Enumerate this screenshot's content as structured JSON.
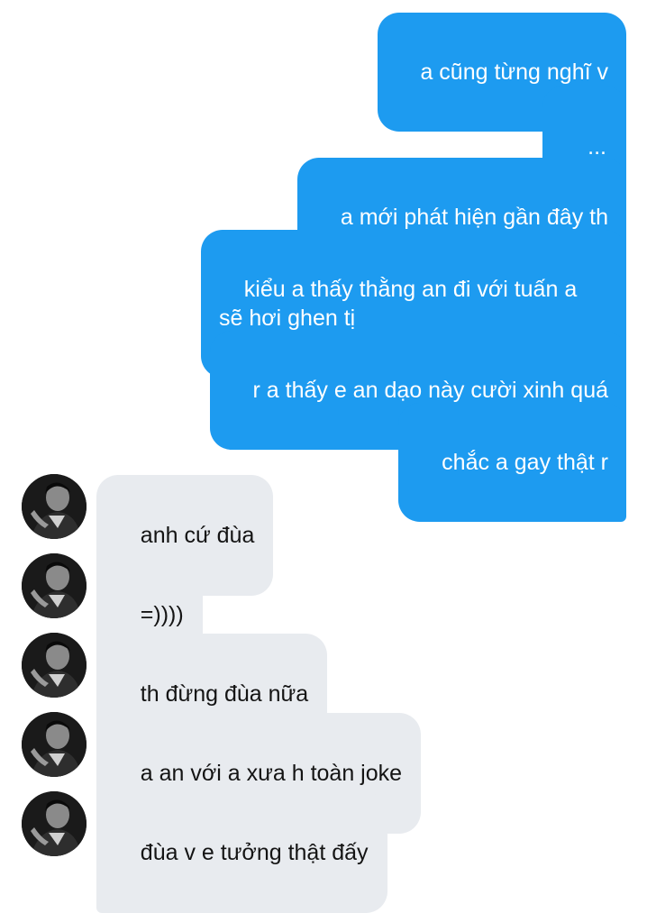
{
  "conversation": {
    "sent_messages": [
      {
        "text": "a cũng từng nghĩ v"
      },
      {
        "text": "..."
      },
      {
        "text": "a mới phát hiện gần đây th"
      },
      {
        "text": "kiểu a thấy thằng an đi với tuấn a\nsẽ hơi ghen tị"
      },
      {
        "text": "r a thấy e an dạo này cười xinh quá"
      },
      {
        "text": "chắc a gay thật r"
      }
    ],
    "received_messages": [
      {
        "text": "anh cứ đùa",
        "avatar_icon": "profile-photo-icon"
      },
      {
        "text": "=))))",
        "avatar_icon": "profile-photo-icon"
      },
      {
        "text": "th đừng đùa nữa",
        "avatar_icon": "profile-photo-icon"
      },
      {
        "text": "a an với a xưa h toàn joke",
        "avatar_icon": "profile-photo-icon"
      },
      {
        "text": "đùa v e tưởng thật đấy",
        "avatar_icon": "profile-photo-icon"
      }
    ]
  },
  "colors": {
    "sent_bubble": "#1d9bf0",
    "received_bubble": "#e8ebef",
    "received_text": "#141414",
    "background": "#ffffff"
  }
}
